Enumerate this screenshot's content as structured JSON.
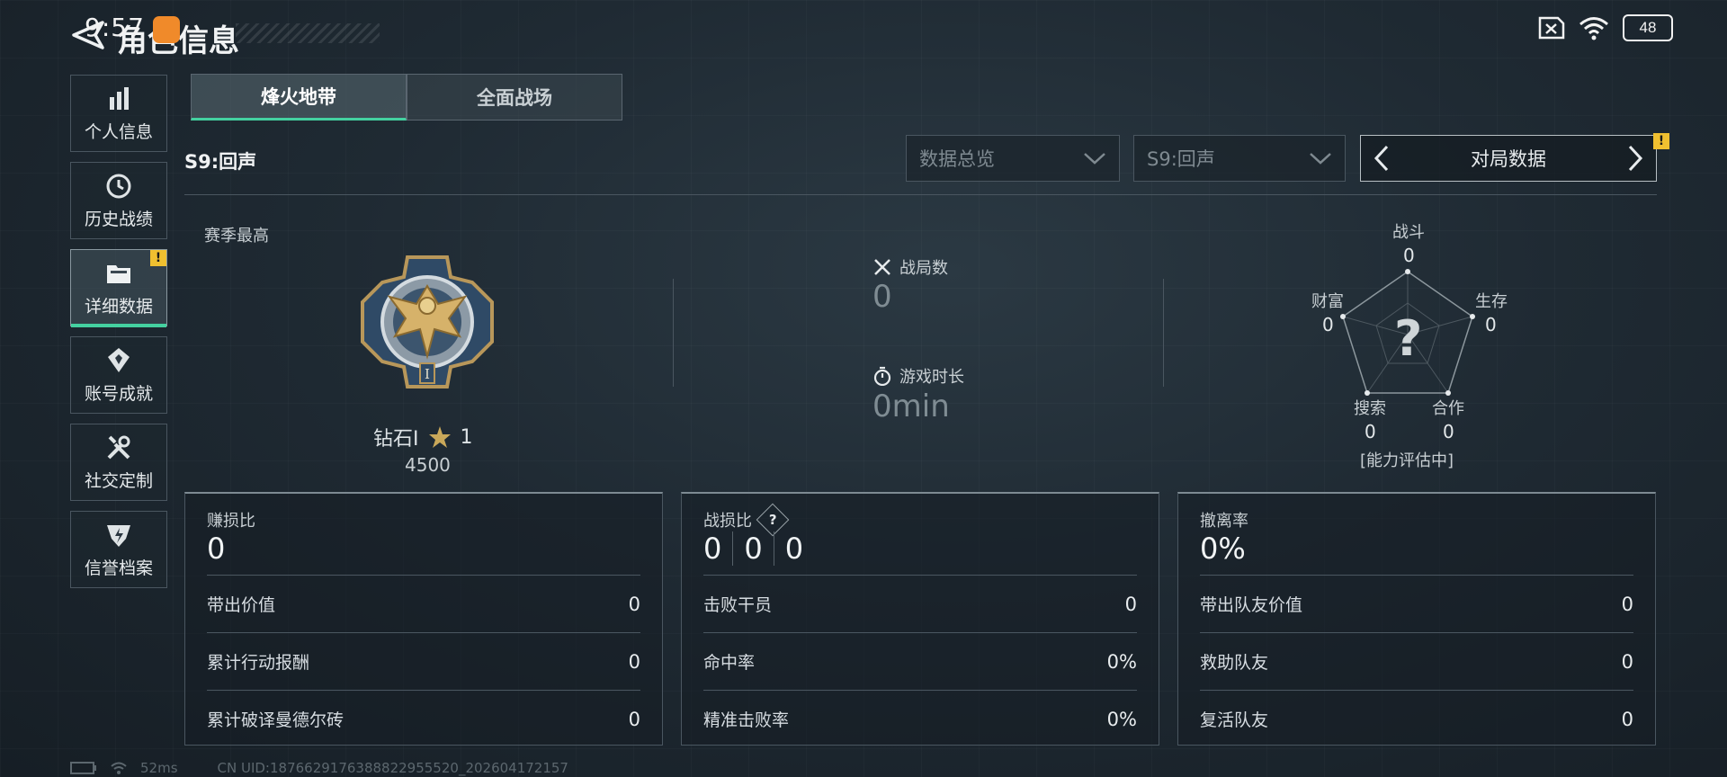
{
  "status_bar": {
    "time": "9:57",
    "battery": "48",
    "wifi_icon": "wifi-icon",
    "sim_icon": "sim-off-icon"
  },
  "header": {
    "title": "角色信息",
    "back_icon": "back-arrow-icon"
  },
  "sidebar": {
    "items": [
      {
        "label": "个人信息",
        "icon": "bar-chart-icon",
        "active": false
      },
      {
        "label": "历史战绩",
        "icon": "clock-icon",
        "active": false
      },
      {
        "label": "详细数据",
        "icon": "folder-icon",
        "active": true,
        "badge": "!"
      },
      {
        "label": "账号成就",
        "icon": "badge-icon",
        "active": false
      },
      {
        "label": "社交定制",
        "icon": "tools-icon",
        "active": false
      },
      {
        "label": "信誉档案",
        "icon": "shield-icon",
        "active": false
      }
    ]
  },
  "tabs": [
    {
      "label": "烽火地带",
      "active": true
    },
    {
      "label": "全面战场",
      "active": false
    }
  ],
  "season_label": "S9:回声",
  "filters": {
    "overview": "数据总览",
    "season": "S9:回声",
    "pager_label": "对局数据",
    "pager_badge": "!"
  },
  "rank": {
    "season_best_label": "赛季最高",
    "tier": "钻石I",
    "stars": "1",
    "score": "4500"
  },
  "stats": {
    "battles_label": "战局数",
    "battles_value": "0",
    "playtime_label": "游戏时长",
    "playtime_value": "0min"
  },
  "radar": {
    "combat_label": "战斗",
    "combat_value": "0",
    "survival_label": "生存",
    "survival_value": "0",
    "teamwork_label": "合作",
    "teamwork_value": "0",
    "search_label": "搜索",
    "search_value": "0",
    "wealth_label": "财富",
    "wealth_value": "0",
    "center_symbol": "?",
    "status": "[能力评估中]"
  },
  "panels": [
    {
      "title": "赚损比",
      "main": "0",
      "rows": [
        {
          "label": "带出价值",
          "value": "0"
        },
        {
          "label": "累计行动报酬",
          "value": "0"
        },
        {
          "label": "累计破译曼德尔砖",
          "value": "0"
        }
      ]
    },
    {
      "title": "战损比",
      "help": "?",
      "kd": [
        "0",
        "0",
        "0"
      ],
      "rows": [
        {
          "label": "击败干员",
          "value": "0"
        },
        {
          "label": "命中率",
          "value": "0%"
        },
        {
          "label": "精准击败率",
          "value": "0%"
        }
      ]
    },
    {
      "title": "撤离率",
      "main": "0%",
      "rows": [
        {
          "label": "带出队友价值",
          "value": "0"
        },
        {
          "label": "救助队友",
          "value": "0"
        },
        {
          "label": "复活队友",
          "value": "0"
        }
      ]
    }
  ],
  "footer": {
    "ping": "52ms",
    "uid": "CN UID:1876629176388822955520_202604172157"
  },
  "colors": {
    "accent": "#44d1a0",
    "badge": "#f0c030",
    "notification": "#f08a2a"
  }
}
